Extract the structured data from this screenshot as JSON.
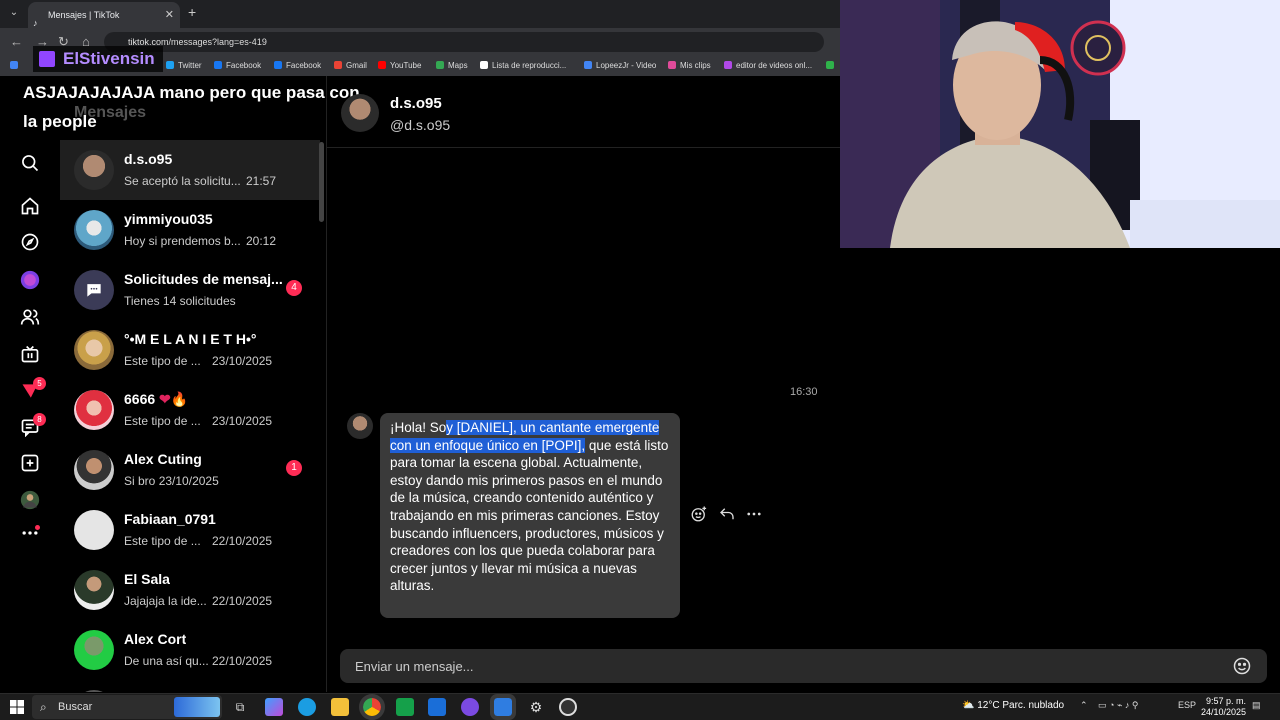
{
  "browser": {
    "tab_title": "Mensajes | TikTok",
    "url": "tiktok.com/messages?lang=es-419",
    "bookmarks": [
      "Twitter",
      "Facebook",
      "Facebook",
      "Gmail",
      "YouTube",
      "Maps",
      "Lista de reproducci...",
      "LopeezJr - Video",
      "Mis clips",
      "editor de videos onl..."
    ]
  },
  "overlay": {
    "streamer": "ElStivensin",
    "chat_message": "ASJAJAJAJAJA mano pero que pasa con la people"
  },
  "app": {
    "title": "Mensajes",
    "nav_badges": {
      "inbox_filter": "5",
      "messages": "8"
    }
  },
  "conversations": [
    {
      "name": "d.s.o95",
      "snippet": "Se aceptó la solicitu...",
      "time": "21:57"
    },
    {
      "name": "yimmiyou035",
      "snippet": "Hoy si prendemos b...",
      "time": "20:12"
    },
    {
      "name": "Solicitudes de mensaj...",
      "snippet": "Tienes 14 solicitudes",
      "time": "",
      "badge": "4"
    },
    {
      "name": "°•M E L A N I E T H•°",
      "snippet": "Este tipo de ...",
      "time": "23/10/2025"
    },
    {
      "name": "6666",
      "snippet": "Este tipo de ...",
      "time": "23/10/2025"
    },
    {
      "name": "Alex Cuting",
      "snippet": "Si bro",
      "time": "23/10/2025",
      "badge": "1"
    },
    {
      "name": "Fabiaan_0791",
      "snippet": "Este tipo de ...",
      "time": "22/10/2025"
    },
    {
      "name": "El Sala",
      "snippet": "Jajajaja la ide...",
      "time": "22/10/2025"
    },
    {
      "name": "Alex Cort",
      "snippet": "De una así qu...",
      "time": "22/10/2025"
    }
  ],
  "chat": {
    "name": "d.s.o95",
    "handle": "@d.s.o95",
    "timestamp": "16:30",
    "message_pre": "¡Hola! So",
    "message_highlight": "y [DANIEL], un cantante emergente con un enfoque único en [POPI],",
    "message_post": " que está listo para tomar la escena global. Actualmente, estoy dando mis primeros pasos en el mundo de la música, creando contenido auténtico y trabajando en mis primeras canciones. Estoy buscando influencers, productores, músicos y creadores con los que pueda colaborar para crecer juntos y llevar mi música a nuevas alturas.",
    "composer_placeholder": "Enviar un mensaje..."
  },
  "taskbar": {
    "search_label": "Buscar",
    "weather": "12°C  Parc. nublado",
    "lang": "ESP",
    "time": "9:57 p. m.",
    "date": "24/10/2025"
  },
  "colors": {
    "accent": "#fe2c55",
    "highlight": "#1f5fd6",
    "bubble": "#3a3a3a",
    "twitch": "#9146ff"
  }
}
